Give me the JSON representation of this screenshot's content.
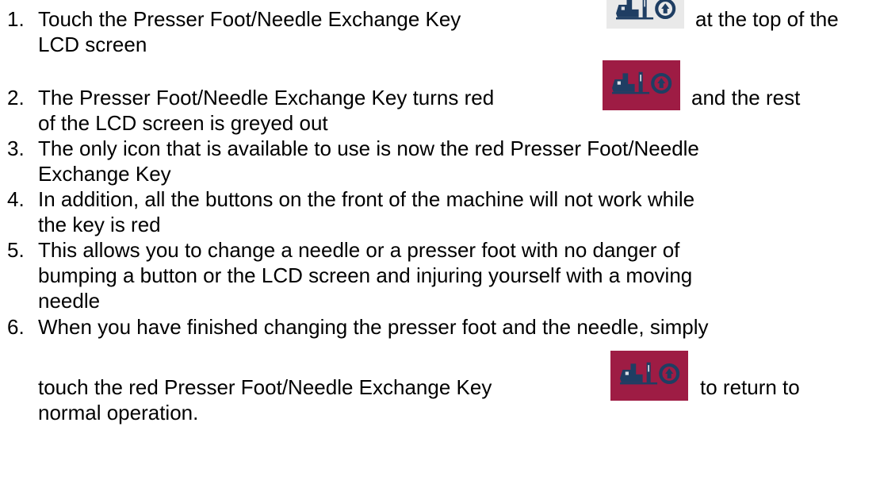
{
  "steps": [
    {
      "number": "1.",
      "line1_before": "Touch the Presser Foot/Needle Exchange Key",
      "line1_after": "at the top of the",
      "line2": "LCD screen",
      "icon": "presser-foot-needle-exchange-key-icon-grey"
    },
    {
      "number": "2.",
      "line1_before": "The Presser Foot/Needle Exchange Key turns red",
      "line1_after": "and the rest",
      "line2": "of the LCD screen is greyed out",
      "icon": "presser-foot-needle-exchange-key-icon-red"
    },
    {
      "number": "3.",
      "line1": "The only icon that is available to use is now the red Presser Foot/Needle",
      "line2": "Exchange Key"
    },
    {
      "number": "4.",
      "line1": "In addition, all the buttons on the front of the machine will not work while",
      "line2": "the key is red"
    },
    {
      "number": "5.",
      "line1": "This allows you to change a needle or a presser foot with no danger of",
      "line2": "bumping a button or the LCD screen and injuring yourself with a moving",
      "line3": "needle"
    },
    {
      "number": "6.",
      "line1": "When you have finished changing the presser foot and the needle, simply",
      "line2_before": "touch the red Presser Foot/Needle Exchange Key",
      "line2_after": "to return to",
      "line3": "normal operation.",
      "icon": "presser-foot-needle-exchange-key-icon-red"
    }
  ],
  "colors": {
    "key_red": "#9e1c44",
    "key_grey": "#e9e9e9",
    "icon_ink": "#1f3e63"
  }
}
